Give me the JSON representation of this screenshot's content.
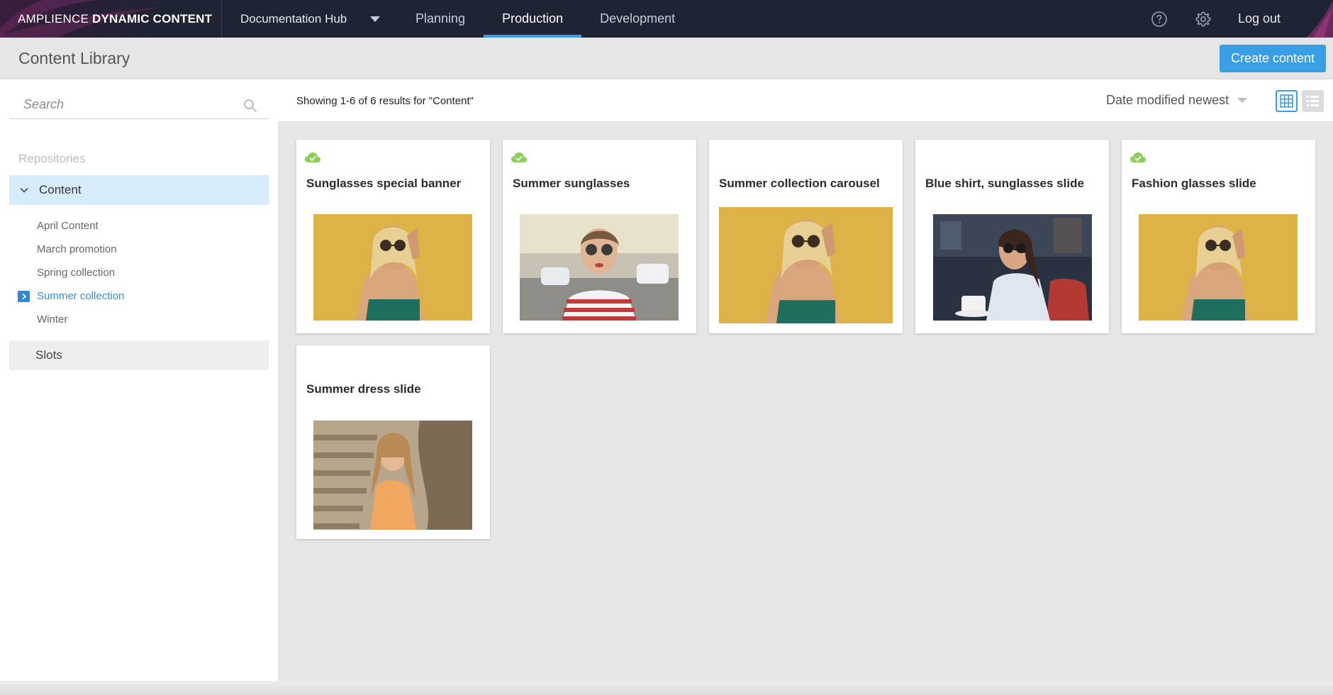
{
  "topnav": {
    "brand_light": "AMPLIENCE",
    "brand_bold": "DYNAMIC CONTENT",
    "hub": "Documentation Hub",
    "tabs": [
      {
        "label": "Planning"
      },
      {
        "label": "Production"
      },
      {
        "label": "Development"
      }
    ],
    "active_tab": "Production",
    "help_icon": "help-circle-icon",
    "settings_icon": "gear-icon",
    "logout": "Log out"
  },
  "header": {
    "title": "Content Library",
    "create_button": "Create content"
  },
  "sidebar": {
    "search_placeholder": "Search",
    "repositories_label": "Repositories",
    "repository": "Content",
    "folders": [
      {
        "label": "April Content"
      },
      {
        "label": "March promotion"
      },
      {
        "label": "Spring collection"
      },
      {
        "label": "Summer collection"
      },
      {
        "label": "Winter"
      }
    ],
    "active_folder": "Summer collection",
    "slots": "Slots"
  },
  "toolbar": {
    "results_text": "Showing 1-6 of 6 results for \"Content\"",
    "sort_label": "Date modified newest",
    "view_mode": "grid"
  },
  "cards": [
    {
      "title": "Sunglasses special banner",
      "published": true,
      "image": "yellow-wall-sunglasses-woman"
    },
    {
      "title": "Summer sunglasses",
      "published": true,
      "image": "street-striped-shirt-woman"
    },
    {
      "title": "Summer collection carousel",
      "published": false,
      "image": "yellow-wall-sunglasses-woman"
    },
    {
      "title": "Blue shirt, sunglasses slide",
      "published": false,
      "image": "cafe-blue-shirt-woman"
    },
    {
      "title": "Fashion glasses slide",
      "published": true,
      "image": "yellow-wall-sunglasses-woman"
    },
    {
      "title": "Summer dress slide",
      "published": false,
      "image": "steps-orange-dress-woman"
    }
  ],
  "colors": {
    "nav_bg": "#1f2433",
    "accent": "#3a9ee4",
    "selected_repo_bg": "#d6ecfa",
    "published_green": "#8dcf5a"
  }
}
